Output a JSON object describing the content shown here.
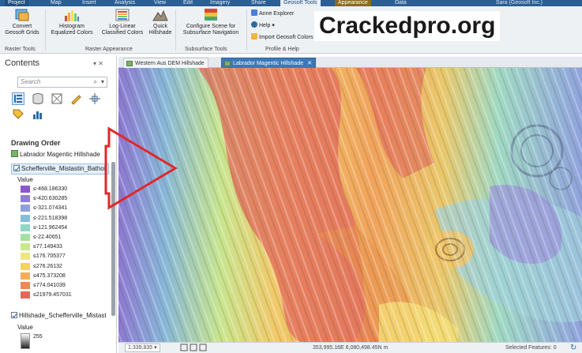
{
  "ribbon_tabs": {
    "project": "Project",
    "map": "Map",
    "insert": "Insert",
    "analysis": "Analysis",
    "view": "View",
    "edit": "Edit",
    "imagery": "Imagery",
    "share": "Share",
    "geosoft_tools": "Geosoft Tools",
    "appearance": "Appearance",
    "data": "Data",
    "account": "Sara (Geosoft Inc.)"
  },
  "ribbon": {
    "convert_grids": [
      "Convert",
      "Geosoft Grids"
    ],
    "histogram_colors": [
      "Histogram",
      "Equalized Colors"
    ],
    "loglinear_colors": [
      "Log-Linear",
      "Classified Colors"
    ],
    "quick_hillshade": [
      "Quick",
      "Hillshade"
    ],
    "configure_scene": [
      "Configure Scene for",
      "Subsurface Navigation"
    ],
    "anne_explorer": "Anne Explorer",
    "help": "Help ▾",
    "import_colors": "Import Geosoft Colors",
    "group_raster_tools": "Raster Tools",
    "group_raster_appearance": "Raster Appearance",
    "group_subsurface_tools": "Subsurface Tools",
    "group_profile_help": "Profile & Help"
  },
  "watermark": "Crackedpro.org",
  "contents": {
    "title": "Contents",
    "pin": "▾ ✕",
    "search_placeholder": "Search",
    "search_icon": "⌕",
    "search_dropdown": "▾",
    "drawing_order": "Drawing Order",
    "map_layer": "Labrador Magentic Hillshade",
    "layer1": "Schefferville_Mistastin_Batholi",
    "value_label": "Value",
    "legend": [
      {
        "label": "≤-468.186330",
        "color": "#8a58c9"
      },
      {
        "label": "≤-420.630285",
        "color": "#8f7fd6"
      },
      {
        "label": "≤-321.074341",
        "color": "#8fa0dc"
      },
      {
        "label": "≤-221.518398",
        "color": "#86bed9"
      },
      {
        "label": "≤-121.962454",
        "color": "#8fd6c4"
      },
      {
        "label": "≤-22.40651",
        "color": "#a4e0a0"
      },
      {
        "label": "≤77.149433",
        "color": "#cbe78b"
      },
      {
        "label": "≤176.705377",
        "color": "#eee682"
      },
      {
        "label": "≤276.26132",
        "color": "#f6cf6b"
      },
      {
        "label": "≤475.373208",
        "color": "#f3ae5c"
      },
      {
        "label": "≤774.041039",
        "color": "#ea8a55"
      },
      {
        "label": "≤21979.457031",
        "color": "#e06a5a"
      }
    ],
    "layer2": "Hillshade_Schefferville_Mistast",
    "value_label2": "Value",
    "hillshade_max": "255"
  },
  "map_tabs": {
    "tab1": "Western Aus DEM Hillshade",
    "tab2": "Labrador Magentic Hillshade",
    "close": "✕"
  },
  "status": {
    "scale": "1:339,835",
    "scale_dropdown": "▾",
    "coordinates": "353,995.16E 6,080,498.45N m",
    "selected": "Selected Features: 0",
    "refresh": "↻"
  },
  "colors": {
    "ribbon_tab_bar": "#2b5f94",
    "map_tab_active": "#3b78b8",
    "arrow": "#e0282a"
  }
}
